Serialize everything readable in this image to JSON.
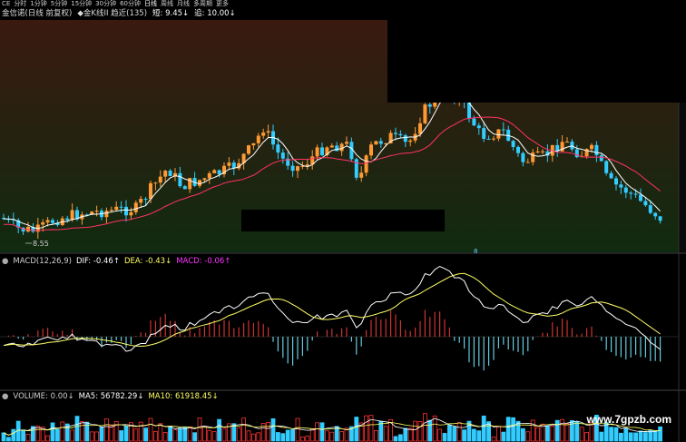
{
  "toolbar": {
    "items": [
      "CE",
      "分时",
      "1分钟",
      "5分钟",
      "15分钟",
      "30分钟",
      "60分钟",
      "日线",
      "周线",
      "月线",
      "多周期",
      "更多"
    ],
    "active_index": 7
  },
  "info": {
    "stock": "金信诺(日线 前复权)",
    "indicator": "◆金K线II 趋近(135)",
    "short_label": "短: 9.45↓",
    "long_label": "追: 10.00↓",
    "stock_color": "#d9d9d9",
    "indicator_color": "#d9d9d9",
    "short_color": "#ffffff",
    "long_color": "#ffffff"
  },
  "price_panel": {
    "low_label": "8.55",
    "marker_label": "8",
    "colors": {
      "up": "#ff9933",
      "down": "#33ccff",
      "ma_short": "#ffffff",
      "ma_long": "#ff3366"
    }
  },
  "macd": {
    "title": "MACD(12,26,9)",
    "dif": "DIF: -0.46↑",
    "dea": "DEA: -0.43↓",
    "macd": "MACD: -0.06↑",
    "colors": {
      "title": "#cfcfcf",
      "dif": "#ffffff",
      "dea": "#ffff66",
      "macd": "#ff33ff",
      "pos_bar": "#cc3333",
      "neg_bar": "#66ccdd"
    }
  },
  "volume": {
    "title": "VOLUME: 0.00↓",
    "ma5": "MA5: 56782.29↓",
    "ma10": "MA10: 61918.45↓",
    "colors": {
      "title": "#cfcfcf",
      "ma5": "#ffffff",
      "ma10": "#ffff66"
    }
  },
  "watermark": "www.7gpzb.com"
}
